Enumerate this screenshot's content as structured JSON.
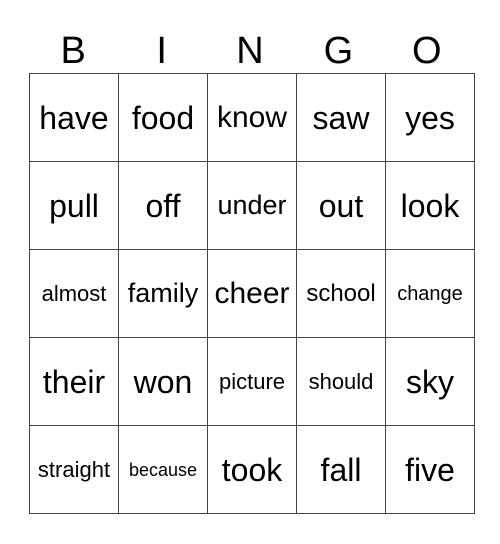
{
  "header": {
    "letters": [
      "B",
      "I",
      "N",
      "G",
      "O"
    ]
  },
  "card": {
    "rows": [
      [
        "have",
        "food",
        "know",
        "saw",
        "yes"
      ],
      [
        "pull",
        "off",
        "under",
        "out",
        "look"
      ],
      [
        "almost",
        "family",
        "cheer",
        "school",
        "change"
      ],
      [
        "their",
        "won",
        "picture",
        "should",
        "sky"
      ],
      [
        "straight",
        "because",
        "took",
        "fall",
        "five"
      ]
    ]
  }
}
